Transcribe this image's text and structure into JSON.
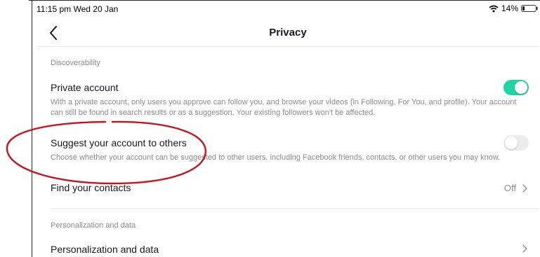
{
  "status_bar": {
    "time": "11:15 pm  Wed 20 Jan",
    "battery": "14%"
  },
  "header": {
    "title": "Privacy"
  },
  "discoverability": {
    "section_label": "Discoverability",
    "private_account": {
      "title": "Private account",
      "description": "With a private account, only users you approve can follow you, and browse your videos (in Following, For You, and profile). Your account can still be found in search results or as a suggestion. Your existing followers won't be affected.",
      "enabled": true
    },
    "suggest_account": {
      "title": "Suggest your account to others",
      "description": "Choose whether your account can be suggested to other users, including Facebook friends, contacts, or other users you may know.",
      "enabled": false
    },
    "find_contacts": {
      "title": "Find your contacts",
      "value": "Off"
    }
  },
  "personalization": {
    "section_label": "Personalization and data",
    "row_title": "Personalization and data"
  },
  "colors": {
    "toggle_on": "#20d5a4",
    "annotation": "#c8141e"
  }
}
